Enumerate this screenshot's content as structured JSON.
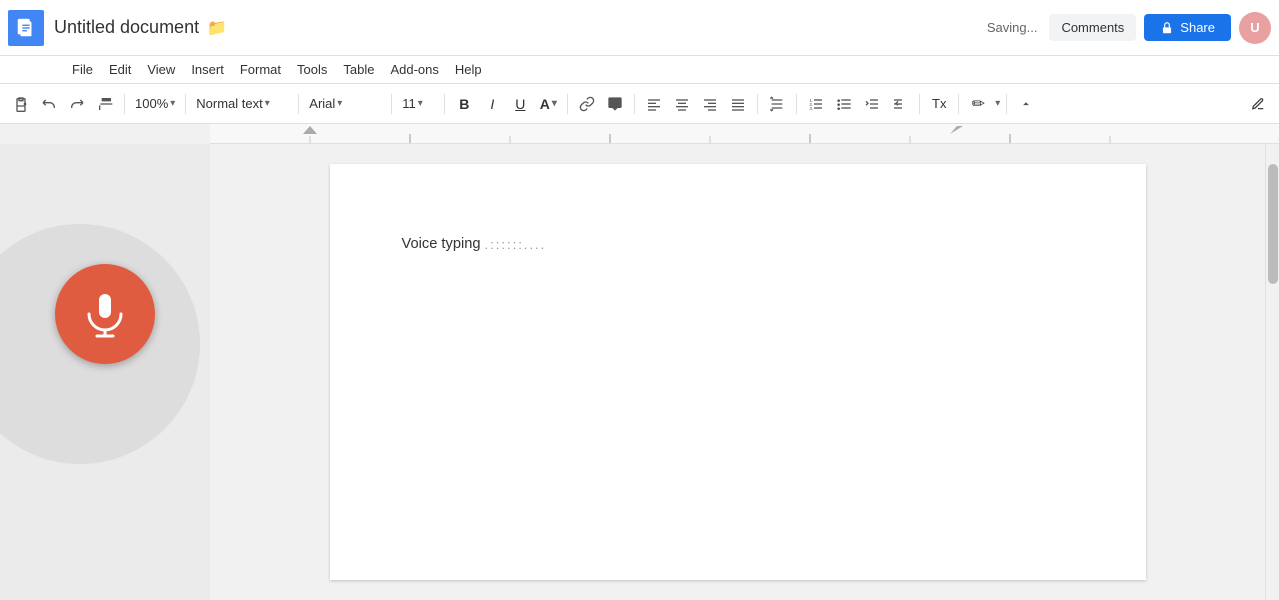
{
  "header": {
    "app_icon_label": "Docs",
    "doc_title": "Untitled document",
    "folder_icon": "📁",
    "saving_text": "Saving...",
    "comments_label": "Comments",
    "share_label": "Share",
    "avatar_initials": "U"
  },
  "menubar": {
    "items": [
      {
        "label": "File",
        "id": "file"
      },
      {
        "label": "Edit",
        "id": "edit"
      },
      {
        "label": "View",
        "id": "view"
      },
      {
        "label": "Insert",
        "id": "insert"
      },
      {
        "label": "Format",
        "id": "format"
      },
      {
        "label": "Tools",
        "id": "tools"
      },
      {
        "label": "Table",
        "id": "table"
      },
      {
        "label": "Add-ons",
        "id": "addons"
      },
      {
        "label": "Help",
        "id": "help"
      }
    ]
  },
  "toolbar": {
    "zoom_value": "100%",
    "style_dropdown": "Normal text",
    "font_dropdown": "Arial",
    "font_size": "11",
    "bold_label": "B",
    "italic_label": "I",
    "underline_label": "U",
    "text_color_label": "A"
  },
  "document": {
    "content_text": "Voice typing",
    "voice_dots": ".::::::...."
  },
  "voice_panel": {
    "mic_button_label": "Microphone"
  }
}
